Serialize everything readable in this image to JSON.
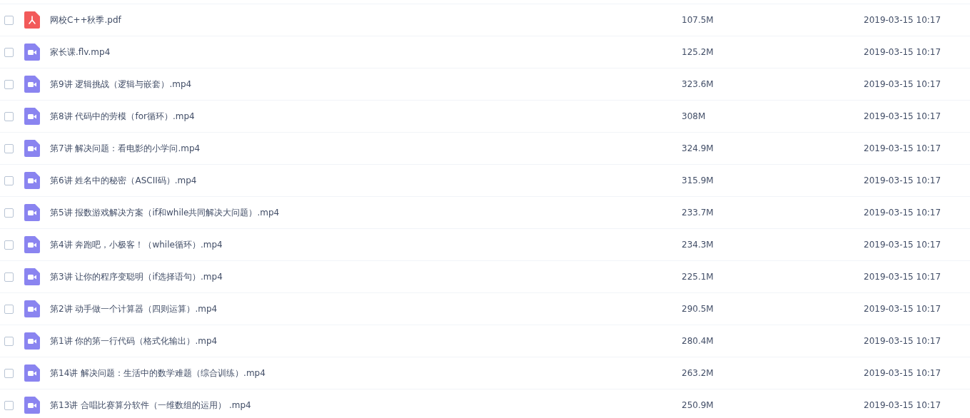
{
  "files": [
    {
      "kind": "pdf",
      "checked": false,
      "name": "网校C++秋季.pdf",
      "size": "107.5M",
      "modified": "2019-03-15 10:17"
    },
    {
      "kind": "video",
      "checked": false,
      "name": "家长课.flv.mp4",
      "size": "125.2M",
      "modified": "2019-03-15 10:17"
    },
    {
      "kind": "video",
      "checked": false,
      "name": "第9讲 逻辑挑战（逻辑与嵌套）.mp4",
      "size": "323.6M",
      "modified": "2019-03-15 10:17"
    },
    {
      "kind": "video",
      "checked": false,
      "name": "第8讲 代码中的劳模（for循环）.mp4",
      "size": "308M",
      "modified": "2019-03-15 10:17"
    },
    {
      "kind": "video",
      "checked": false,
      "name": "第7讲 解决问题：看电影的小学问.mp4",
      "size": "324.9M",
      "modified": "2019-03-15 10:17"
    },
    {
      "kind": "video",
      "checked": false,
      "name": "第6讲 姓名中的秘密（ASCII码）.mp4",
      "size": "315.9M",
      "modified": "2019-03-15 10:17"
    },
    {
      "kind": "video",
      "checked": false,
      "name": "第5讲 报数游戏解决方案（if和while共同解决大问题）.mp4",
      "size": "233.7M",
      "modified": "2019-03-15 10:17"
    },
    {
      "kind": "video",
      "checked": false,
      "name": "第4讲 奔跑吧，小极客！（while循环）.mp4",
      "size": "234.3M",
      "modified": "2019-03-15 10:17"
    },
    {
      "kind": "video",
      "checked": false,
      "name": "第3讲 让你的程序变聪明（if选择语句）.mp4",
      "size": "225.1M",
      "modified": "2019-03-15 10:17"
    },
    {
      "kind": "video",
      "checked": false,
      "name": "第2讲 动手做一个计算器（四则运算）.mp4",
      "size": "290.5M",
      "modified": "2019-03-15 10:17"
    },
    {
      "kind": "video",
      "checked": false,
      "name": "第1讲 你的第一行代码（格式化输出）.mp4",
      "size": "280.4M",
      "modified": "2019-03-15 10:17"
    },
    {
      "kind": "video",
      "checked": false,
      "name": "第14讲 解决问题：生活中的数学难题（综合训练）.mp4",
      "size": "263.2M",
      "modified": "2019-03-15 10:17"
    },
    {
      "kind": "video",
      "checked": false,
      "name": "第13讲 合唱比赛算分软件（一维数组的运用） .mp4",
      "size": "250.9M",
      "modified": "2019-03-15 10:17"
    }
  ]
}
